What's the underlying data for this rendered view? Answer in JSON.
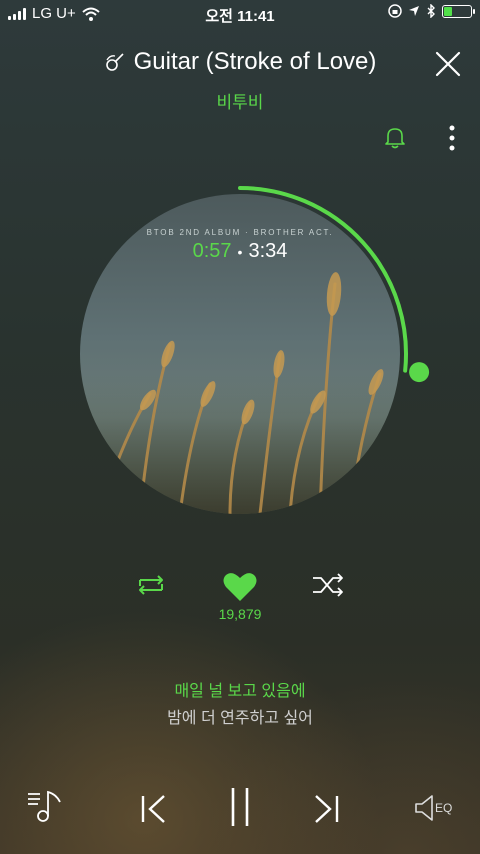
{
  "status_bar": {
    "carrier": "LG U+",
    "time": "오전 11:41",
    "battery_level": 0.3
  },
  "song": {
    "title": "Guitar (Stroke of Love)",
    "artist": "비투비",
    "album_label": "BTOB 2ND ALBUM · BROTHER ACT.",
    "elapsed": "0:57",
    "total": "3:34",
    "progress": 0.266
  },
  "actions": {
    "like_count": "19,879"
  },
  "lyrics": {
    "current": "매일 널 보고 있음에",
    "next": "밤에 더 연주하고 싶어"
  },
  "bottom_bar": {
    "eq_label": "EQ"
  },
  "colors": {
    "accent": "#5ad84a"
  },
  "icons": [
    "signal-icon",
    "wifi-icon",
    "lock-rotation-icon",
    "location-icon",
    "bluetooth-icon",
    "battery-icon",
    "guitar-icon",
    "close-icon",
    "bell-icon",
    "more-icon",
    "repeat-icon",
    "heart-icon",
    "shuffle-icon",
    "playlist-icon",
    "previous-icon",
    "pause-icon",
    "next-icon",
    "eq-speaker-icon"
  ]
}
